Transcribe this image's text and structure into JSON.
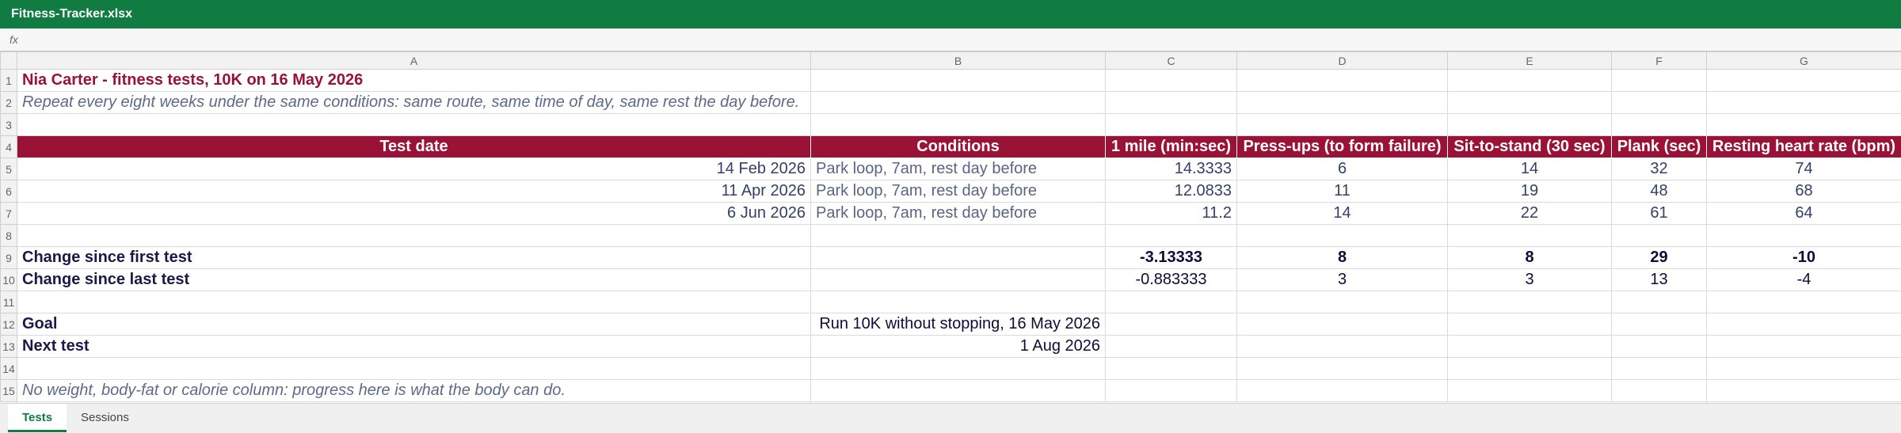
{
  "window": {
    "title": "Fitness-Tracker.xlsx"
  },
  "formula_bar": {
    "fx_label": "fx"
  },
  "columns": [
    "A",
    "B",
    "C",
    "D",
    "E",
    "F",
    "G"
  ],
  "rows": [
    "1",
    "2",
    "3",
    "4",
    "5",
    "6",
    "7",
    "8",
    "9",
    "10",
    "11",
    "12",
    "13",
    "14",
    "15"
  ],
  "sheet": {
    "title": "Nia Carter - fitness tests, 10K on 16 May 2026",
    "subtitle": "Repeat every eight weeks under the same conditions: same route, same time of day, same rest the day before.",
    "headers": [
      "Test date",
      "Conditions",
      "1 mile (min:sec)",
      "Press-ups (to form failure)",
      "Sit-to-stand (30 sec)",
      "Plank (sec)",
      "Resting heart rate (bpm)"
    ],
    "tests": [
      {
        "date": "14 Feb 2026",
        "conditions": "Park loop, 7am, rest day before",
        "mile": "14.3333",
        "pressups": "6",
        "sit": "14",
        "plank": "32",
        "rhr": "74"
      },
      {
        "date": "11 Apr 2026",
        "conditions": "Park loop, 7am, rest day before",
        "mile": "12.0833",
        "pressups": "11",
        "sit": "19",
        "plank": "48",
        "rhr": "68"
      },
      {
        "date": "6 Jun 2026",
        "conditions": "Park loop, 7am, rest day before",
        "mile": "11.2",
        "pressups": "14",
        "sit": "22",
        "plank": "61",
        "rhr": "64"
      }
    ],
    "change_first": {
      "label": "Change since first test",
      "mile": "-3.13333",
      "pressups": "8",
      "sit": "8",
      "plank": "29",
      "rhr": "-10"
    },
    "change_last": {
      "label": "Change since last test",
      "mile": "-0.883333",
      "pressups": "3",
      "sit": "3",
      "plank": "13",
      "rhr": "-4"
    },
    "goal": {
      "label": "Goal",
      "value": "Run 10K without stopping, 16 May 2026"
    },
    "next_test": {
      "label": "Next test",
      "value": "1 Aug 2026"
    },
    "note": "No weight, body-fat or calorie column: progress here is what the body can do."
  },
  "tabs": [
    {
      "label": "Tests",
      "active": true
    },
    {
      "label": "Sessions",
      "active": false
    }
  ],
  "colors": {
    "title_bar": "#107c41",
    "header_fill": "#9b1237",
    "title_text": "#9b1237"
  }
}
